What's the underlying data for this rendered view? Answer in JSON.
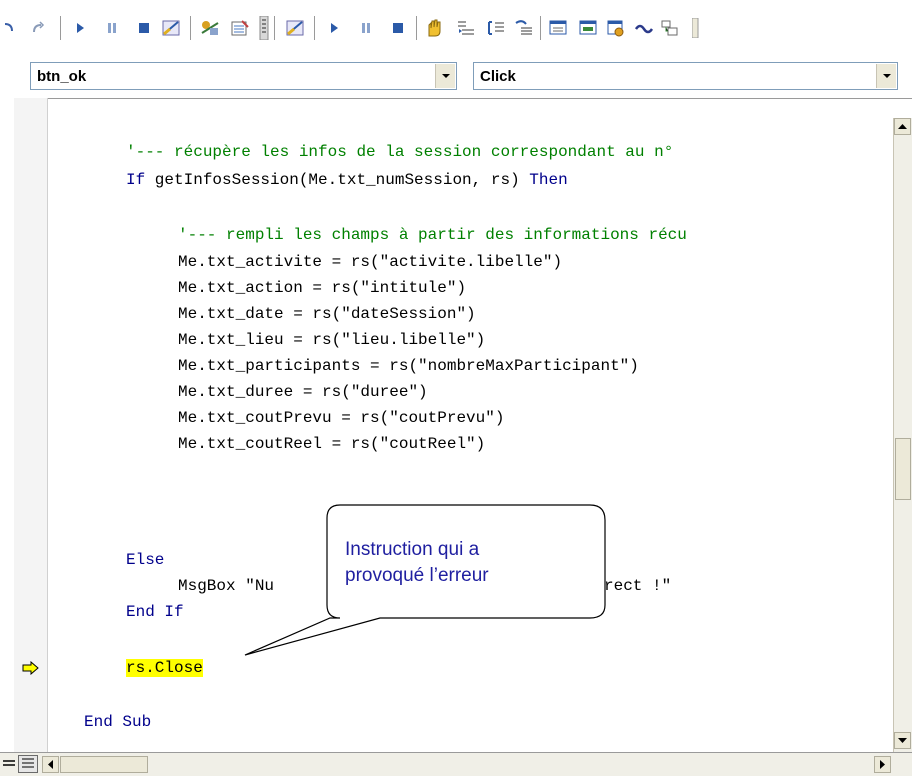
{
  "toolbar": {
    "icons": [
      "redo-icon",
      "run-icon",
      "break-icon",
      "reset-icon",
      "design-mode-icon",
      "project-explorer-icon",
      "properties-icon",
      "toolbox-icon",
      "design-mode-icon-2",
      "run-icon-2",
      "break-icon-2",
      "reset-icon-2",
      "toggle-breakpoint-icon",
      "step-into-icon",
      "step-over-icon",
      "step-out-icon",
      "locals-window-icon",
      "immediate-window-icon",
      "watch-window-icon",
      "quick-watch-icon",
      "call-stack-icon"
    ]
  },
  "object_combo": {
    "value": "btn_ok"
  },
  "procedure_combo": {
    "value": "Click"
  },
  "code": {
    "lines": [
      {
        "indent": "    ",
        "text": "'--- récupère les infos de la session correspondant au n°",
        "type": "comment"
      },
      {
        "indent": "    ",
        "kw1": "If",
        "text": " getInfosSession(Me.txt_numSession, rs) ",
        "kw2": "Then",
        "type": "if"
      },
      {
        "indent": "",
        "text": "",
        "type": "blank"
      },
      {
        "indent": "        ",
        "text": "'--- rempli les champs à partir des informations récu",
        "type": "comment"
      },
      {
        "indent": "        ",
        "text": "Me.txt_activite = rs(\"activite.libelle\")",
        "type": "code"
      },
      {
        "indent": "        ",
        "text": "Me.txt_action = rs(\"intitule\")",
        "type": "code"
      },
      {
        "indent": "        ",
        "text": "Me.txt_date = rs(\"dateSession\")",
        "type": "code"
      },
      {
        "indent": "        ",
        "text": "Me.txt_lieu = rs(\"lieu.libelle\")",
        "type": "code"
      },
      {
        "indent": "        ",
        "text": "Me.txt_participants = rs(\"nombreMaxParticipant\")",
        "type": "code"
      },
      {
        "indent": "        ",
        "text": "Me.txt_duree = rs(\"duree\")",
        "type": "code"
      },
      {
        "indent": "        ",
        "text": "Me.txt_coutPrevu = rs(\"coutPrevu\")",
        "type": "code"
      },
      {
        "indent": "        ",
        "text": "Me.txt_coutReel = rs(\"coutReel\")",
        "type": "code"
      }
    ],
    "else_kw": "Else",
    "msgbox_line": "MsgBox \"Nu",
    "msgbox_tail": "rect !\"",
    "endif_kw": "End If",
    "current_line": "rs.Close",
    "end_sub": "End Sub"
  },
  "callout": {
    "text_line1": "Instruction qui a",
    "text_line2": "provoqué l’erreur"
  },
  "colors": {
    "keyword": "#00008b",
    "comment": "#008000",
    "highlight": "#ffff00",
    "callout_text": "#1f1fa0"
  }
}
